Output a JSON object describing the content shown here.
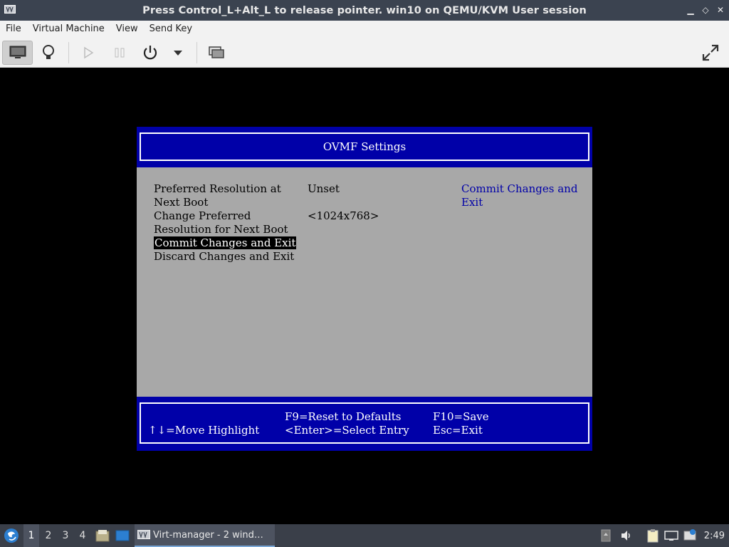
{
  "window": {
    "title": "Press Control_L+Alt_L to release pointer. win10 on QEMU/KVM User session",
    "icon": "vm-icon",
    "buttons": [
      "minimize-icon",
      "restore-icon",
      "close-icon"
    ]
  },
  "menubar": {
    "items": [
      "File",
      "Virtual Machine",
      "View",
      "Send Key"
    ]
  },
  "toolbar": {
    "items": [
      "console-icon",
      "details-icon",
      "run-icon",
      "pause-icon",
      "power-icon",
      "power-menu-icon",
      "snapshots-icon",
      "fullscreen-icon"
    ]
  },
  "bios": {
    "title": "OVMF Settings",
    "options": [
      {
        "label_lines": [
          "Preferred Resolution at",
          "Next Boot"
        ],
        "value": "Unset"
      },
      {
        "label_lines": [
          "Change Preferred",
          "Resolution for Next Boot"
        ],
        "value": "<1024x768>"
      },
      {
        "label_lines": [
          "Commit Changes and Exit"
        ],
        "value": ""
      },
      {
        "label_lines": [
          "Discard Changes and Exit"
        ],
        "value": ""
      }
    ],
    "help_lines": [
      "Commit Changes and",
      "Exit"
    ],
    "footer": {
      "move": "↑↓=Move Highlight",
      "reset": "F9=Reset to Defaults",
      "select": "<Enter>=Select Entry",
      "save": "F10=Save",
      "exit": "Esc=Exit"
    }
  },
  "taskbar": {
    "workspaces": [
      "1",
      "2",
      "3",
      "4"
    ],
    "active_workspace": "1",
    "task_label": "Virt-manager - 2 wind…",
    "clock": "2:49",
    "tray_icons": [
      "drive-icon",
      "volume-icon",
      "clipboard-icon",
      "network-icon",
      "notification-icon"
    ]
  }
}
